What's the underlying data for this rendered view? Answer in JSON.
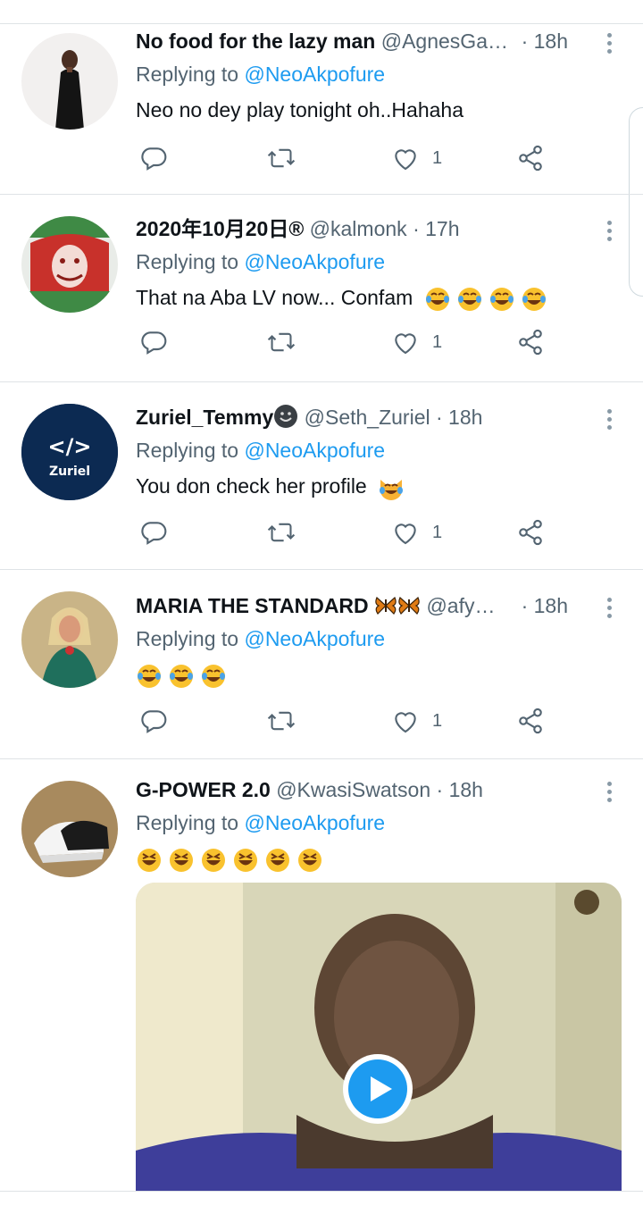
{
  "replying_label": "Replying to",
  "tweets": [
    {
      "display_name": "No food for the lazy man",
      "handle": "@AgnesGa…",
      "time": "· 18h",
      "mention": "@NeoAkpofure",
      "text": "Neo no dey play tonight oh..Hahaha",
      "likes": "1",
      "avatar": "woman-black-dress"
    },
    {
      "display_name": "2020年10月20日®",
      "handle": "@kalmonk",
      "time": "· 17h",
      "mention": "@NeoAkpofure",
      "text": "That na Aba LV now... Confam",
      "emojis": [
        "joy",
        "joy",
        "joy",
        "joy"
      ],
      "likes": "1",
      "avatar": "red-green-portrait"
    },
    {
      "display_name": "Zuriel_Temmy",
      "handle": "@Seth_Zuriel",
      "time": "· 18h",
      "mention": "@NeoAkpofure",
      "text": "You don check her profile",
      "emojis": [
        "cat-joy"
      ],
      "likes": "1",
      "avatar": "zuriel-logo",
      "avatar_text": "Zuriel",
      "avatar_code_glyph": "</>"
    },
    {
      "display_name": "MARIA THE STANDARD",
      "handle": "@afy…",
      "time": "· 18h",
      "mention": "@NeoAkpofure",
      "text": "",
      "emojis": [
        "joy",
        "joy",
        "joy"
      ],
      "likes": "1",
      "avatar": "woman-green-gown"
    },
    {
      "display_name": "G-POWER 2.0",
      "handle": "@KwasiSwatson",
      "time": "· 18h",
      "mention": "@NeoAkpofure",
      "text": "",
      "emojis": [
        "laugh",
        "laugh",
        "laugh",
        "laugh",
        "laugh",
        "laugh"
      ],
      "avatar": "sneakers",
      "media": "video-thumbnail-with-play-button"
    }
  ],
  "colors": {
    "link": "#1d9bf0",
    "secondary_text": "#536471",
    "divider": "#dfe3e6",
    "icon": "#536471"
  },
  "icons": [
    "reply-icon",
    "retweet-icon",
    "like-icon",
    "share-icon",
    "more-icon",
    "play-icon"
  ]
}
